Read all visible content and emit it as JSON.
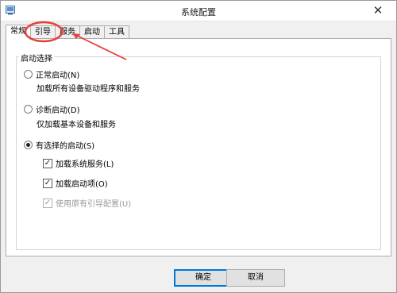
{
  "window": {
    "title": "系统配置",
    "close_glyph": "✕"
  },
  "tabs": [
    {
      "label": "常规",
      "active": true
    },
    {
      "label": "引导",
      "active": false
    },
    {
      "label": "服务",
      "active": false
    },
    {
      "label": "启动",
      "active": false
    },
    {
      "label": "工具",
      "active": false
    }
  ],
  "startup_selection": {
    "group_label": "启动选择",
    "normal": {
      "label": "正常启动(N)",
      "desc": "加载所有设备驱动程序和服务",
      "selected": false
    },
    "diagnostic": {
      "label": "诊断启动(D)",
      "desc": "仅加载基本设备和服务",
      "selected": false
    },
    "selective": {
      "label": "有选择的启动(S)",
      "selected": true
    },
    "options": [
      {
        "label": "加载系统服务(L)",
        "checked": true,
        "enabled": true
      },
      {
        "label": "加载启动项(O)",
        "checked": true,
        "enabled": true
      },
      {
        "label": "使用原有引导配置(U)",
        "checked": true,
        "enabled": false
      }
    ]
  },
  "buttons": {
    "ok": "确定",
    "cancel": "取消"
  },
  "annotation": {
    "color": "#e8413b",
    "target": "引导"
  },
  "icons": {
    "app": "msconfig-icon",
    "close": "close-icon",
    "check": "checkmark-icon"
  }
}
